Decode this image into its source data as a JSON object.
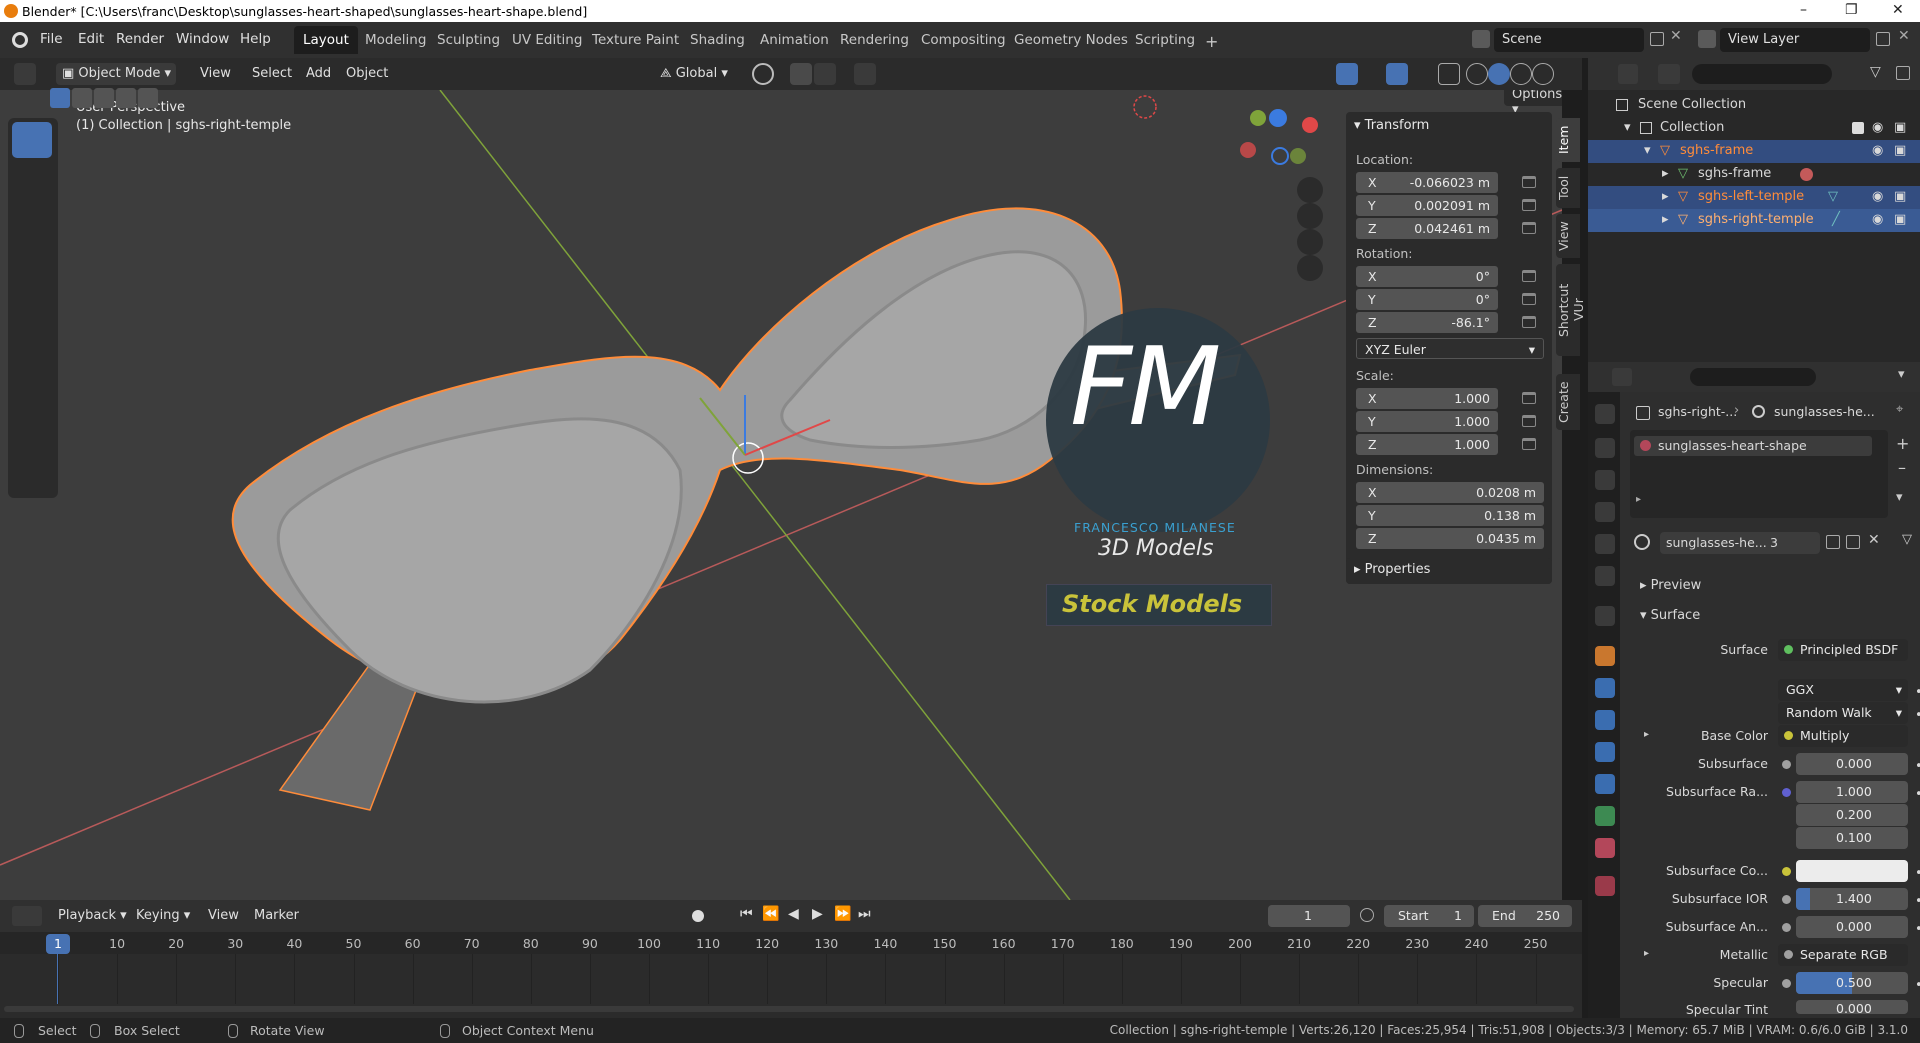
{
  "window": {
    "title": "Blender* [C:\\Users\\franc\\Desktop\\sunglasses-heart-shaped\\sunglasses-heart-shape.blend]"
  },
  "menu": [
    "File",
    "Edit",
    "Render",
    "Window",
    "Help"
  ],
  "workspaces": [
    "Layout",
    "Modeling",
    "Sculpting",
    "UV Editing",
    "Texture Paint",
    "Shading",
    "Animation",
    "Rendering",
    "Compositing",
    "Geometry Nodes",
    "Scripting"
  ],
  "scene": {
    "label": "Scene",
    "view_layer": "View Layer"
  },
  "viewport_header": {
    "mode": "Object Mode",
    "view": "View",
    "select": "Select",
    "add": "Add",
    "object": "Object",
    "orientation": "Global",
    "options": "Options"
  },
  "viewport": {
    "perspective": "User Perspective",
    "collection_info": "(1) Collection | sghs-right-temple"
  },
  "watermark": {
    "initials": "FM",
    "name": "FRANCESCO MILANESE",
    "sub": "3D Models",
    "badge": "Stock Models"
  },
  "npanel": {
    "tabs": [
      "Item",
      "Tool",
      "View",
      "Shortcut VUr",
      "Create"
    ],
    "transform": "Transform",
    "location_label": "Location:",
    "location": [
      {
        "axis": "X",
        "value": "-0.066023 m"
      },
      {
        "axis": "Y",
        "value": "0.002091 m"
      },
      {
        "axis": "Z",
        "value": "0.042461 m"
      }
    ],
    "rotation_label": "Rotation:",
    "rotation": [
      {
        "axis": "X",
        "value": "0°"
      },
      {
        "axis": "Y",
        "value": "0°"
      },
      {
        "axis": "Z",
        "value": "-86.1°"
      }
    ],
    "rotation_mode": "XYZ Euler",
    "scale_label": "Scale:",
    "scale": [
      {
        "axis": "X",
        "value": "1.000"
      },
      {
        "axis": "Y",
        "value": "1.000"
      },
      {
        "axis": "Z",
        "value": "1.000"
      }
    ],
    "dimensions_label": "Dimensions:",
    "dimensions": [
      {
        "axis": "X",
        "value": "0.0208 m"
      },
      {
        "axis": "Y",
        "value": "0.138 m"
      },
      {
        "axis": "Z",
        "value": "0.0435 m"
      }
    ],
    "properties": "Properties"
  },
  "outliner": {
    "items": [
      {
        "label": "Scene Collection",
        "indent": 0
      },
      {
        "label": "Collection",
        "indent": 1
      },
      {
        "label": "sghs-frame",
        "indent": 2
      },
      {
        "label": "sghs-frame",
        "indent": 3
      },
      {
        "label": "sghs-left-temple",
        "indent": 3
      },
      {
        "label": "sghs-right-temple",
        "indent": 3
      }
    ]
  },
  "properties": {
    "breadcrumb_object": "sghs-right-...",
    "breadcrumb_material": "sunglasses-he...",
    "material_slot": "sunglasses-heart-shape",
    "material_name": "sunglasses-he...",
    "users": "3",
    "preview": "Preview",
    "surface_section": "Surface",
    "surface_label": "Surface",
    "surface_value": "Principled BSDF",
    "distribution": "GGX",
    "subsurface_method": "Random Walk",
    "rows": [
      {
        "label": "Base Color",
        "value": "Multiply",
        "type": "link"
      },
      {
        "label": "Subsurface",
        "value": "0.000",
        "type": "num"
      },
      {
        "label": "Subsurface Ra...",
        "value": "1.000",
        "type": "num"
      },
      {
        "label": "",
        "value": "0.200",
        "type": "num"
      },
      {
        "label": "",
        "value": "0.100",
        "type": "num"
      },
      {
        "label": "Subsurface Co...",
        "value": "",
        "type": "color"
      },
      {
        "label": "Subsurface IOR",
        "value": "1.400",
        "type": "num"
      },
      {
        "label": "Subsurface An...",
        "value": "0.000",
        "type": "num"
      },
      {
        "label": "Metallic",
        "value": "Separate RGB",
        "type": "link"
      },
      {
        "label": "Specular",
        "value": "0.500",
        "type": "num"
      },
      {
        "label": "Specular Tint",
        "value": "0.000",
        "type": "num"
      }
    ]
  },
  "timeline": {
    "menus": [
      "Playback",
      "Keying",
      "View",
      "Marker"
    ],
    "current_frame": "1",
    "start_label": "Start",
    "start": "1",
    "end_label": "End",
    "end": "250",
    "frames": [
      "1",
      "10",
      "20",
      "30",
      "40",
      "50",
      "60",
      "70",
      "80",
      "90",
      "100",
      "110",
      "120",
      "130",
      "140",
      "150",
      "160",
      "170",
      "180",
      "190",
      "200",
      "210",
      "220",
      "230",
      "240",
      "250"
    ]
  },
  "status": {
    "select": "Select",
    "box_select": "Box Select",
    "rotate_view": "Rotate View",
    "context_menu": "Object Context Menu",
    "stats": "Collection | sghs-right-temple | Verts:26,120 | Faces:25,954 | Tris:51,908 | Objects:3/3 | Memory: 65.7 MiB | VRAM: 0.6/6.0 GiB | 3.1.0"
  },
  "colors": {
    "accent": "#4772b3",
    "selection": "#ff8c3a",
    "header": "#303030",
    "viewport": "#3d3d3d"
  }
}
